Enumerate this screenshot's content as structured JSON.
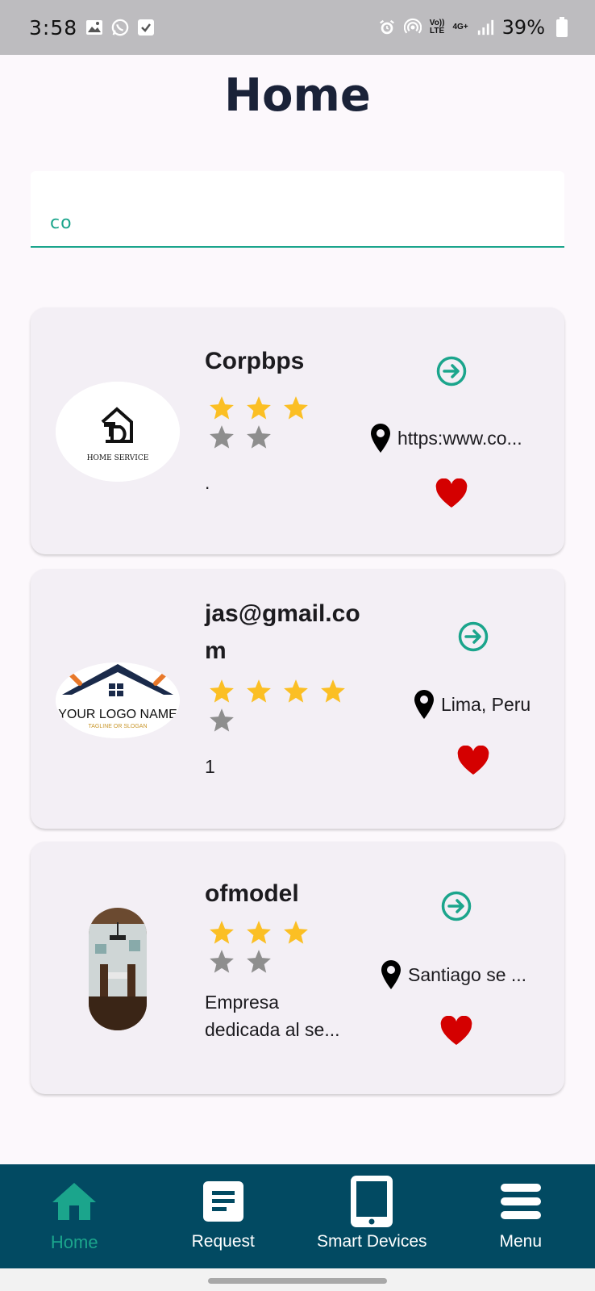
{
  "status_bar": {
    "time": "3:58",
    "battery": "39%",
    "network": "4G+",
    "volte": "Vo)) LTE"
  },
  "header": {
    "title": "Home"
  },
  "search": {
    "value": "co",
    "placeholder": ""
  },
  "colors": {
    "accent": "#1ba58c",
    "nav_background": "#024a62",
    "star_filled": "#fbbf24",
    "star_empty": "#8e8e8e",
    "heart": "#d40000",
    "card_background": "#f3eff5"
  },
  "cards": [
    {
      "name": "Corpbps",
      "rating": 3,
      "max_rating": 5,
      "description": ".",
      "location": "https:www.co...",
      "logo_text": "HOME SERVICE",
      "logo_icon": "house-hammer-logo"
    },
    {
      "name": "jas@gmail.com",
      "rating": 4,
      "max_rating": 5,
      "description": "1",
      "location": "Lima, Peru",
      "logo_text": "YOUR LOGO NAME",
      "logo_subtext": "TAGLINE OR SLOGAN",
      "logo_icon": "roof-tools-logo"
    },
    {
      "name": "ofmodel",
      "rating": 3,
      "max_rating": 5,
      "description": "Empresa dedicada al se...",
      "location": "Santiago se ...",
      "logo_icon": "dining-room-photo"
    }
  ],
  "bottom_nav": [
    {
      "label": "Home",
      "icon": "home-icon",
      "active": true
    },
    {
      "label": "Request",
      "icon": "document-icon",
      "active": false
    },
    {
      "label": "Smart Devices",
      "icon": "tablet-icon",
      "active": false
    },
    {
      "label": "Menu",
      "icon": "menu-icon",
      "active": false
    }
  ]
}
